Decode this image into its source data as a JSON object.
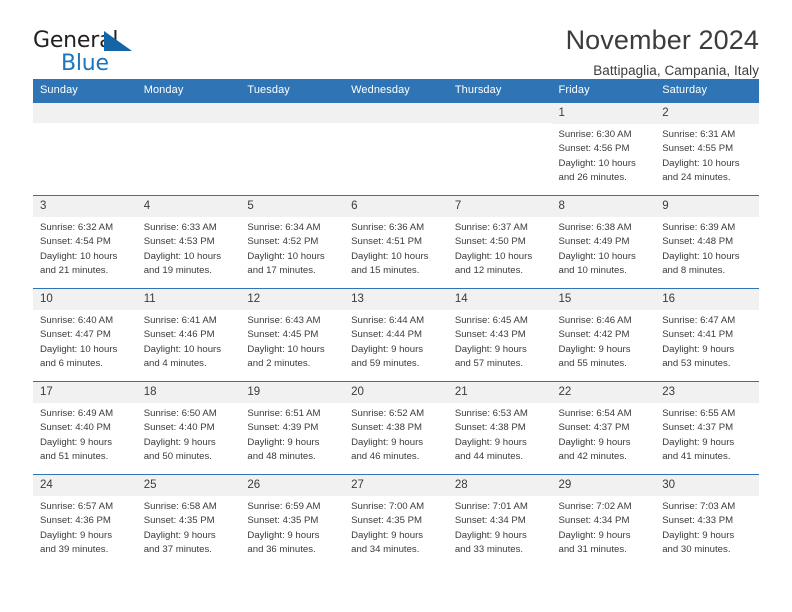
{
  "brand": {
    "name_part1": "General",
    "name_part2": "Blue",
    "logo_icon": "triangle-flag-icon"
  },
  "header": {
    "title": "November 2024",
    "subtitle": "Battipaglia, Campania, Italy"
  },
  "colors": {
    "header_blue": "#2f75b5",
    "brand_blue": "#1d75bd",
    "daynum_bg": "#f1f1f1",
    "text": "#3b3b3b"
  },
  "weekdays": [
    "Sunday",
    "Monday",
    "Tuesday",
    "Wednesday",
    "Thursday",
    "Friday",
    "Saturday"
  ],
  "weeks": [
    [
      {
        "day": "",
        "sunrise": "",
        "sunset": "",
        "daylight1": "",
        "daylight2": ""
      },
      {
        "day": "",
        "sunrise": "",
        "sunset": "",
        "daylight1": "",
        "daylight2": ""
      },
      {
        "day": "",
        "sunrise": "",
        "sunset": "",
        "daylight1": "",
        "daylight2": ""
      },
      {
        "day": "",
        "sunrise": "",
        "sunset": "",
        "daylight1": "",
        "daylight2": ""
      },
      {
        "day": "",
        "sunrise": "",
        "sunset": "",
        "daylight1": "",
        "daylight2": ""
      },
      {
        "day": "1",
        "sunrise": "Sunrise: 6:30 AM",
        "sunset": "Sunset: 4:56 PM",
        "daylight1": "Daylight: 10 hours",
        "daylight2": "and 26 minutes."
      },
      {
        "day": "2",
        "sunrise": "Sunrise: 6:31 AM",
        "sunset": "Sunset: 4:55 PM",
        "daylight1": "Daylight: 10 hours",
        "daylight2": "and 24 minutes."
      }
    ],
    [
      {
        "day": "3",
        "sunrise": "Sunrise: 6:32 AM",
        "sunset": "Sunset: 4:54 PM",
        "daylight1": "Daylight: 10 hours",
        "daylight2": "and 21 minutes."
      },
      {
        "day": "4",
        "sunrise": "Sunrise: 6:33 AM",
        "sunset": "Sunset: 4:53 PM",
        "daylight1": "Daylight: 10 hours",
        "daylight2": "and 19 minutes."
      },
      {
        "day": "5",
        "sunrise": "Sunrise: 6:34 AM",
        "sunset": "Sunset: 4:52 PM",
        "daylight1": "Daylight: 10 hours",
        "daylight2": "and 17 minutes."
      },
      {
        "day": "6",
        "sunrise": "Sunrise: 6:36 AM",
        "sunset": "Sunset: 4:51 PM",
        "daylight1": "Daylight: 10 hours",
        "daylight2": "and 15 minutes."
      },
      {
        "day": "7",
        "sunrise": "Sunrise: 6:37 AM",
        "sunset": "Sunset: 4:50 PM",
        "daylight1": "Daylight: 10 hours",
        "daylight2": "and 12 minutes."
      },
      {
        "day": "8",
        "sunrise": "Sunrise: 6:38 AM",
        "sunset": "Sunset: 4:49 PM",
        "daylight1": "Daylight: 10 hours",
        "daylight2": "and 10 minutes."
      },
      {
        "day": "9",
        "sunrise": "Sunrise: 6:39 AM",
        "sunset": "Sunset: 4:48 PM",
        "daylight1": "Daylight: 10 hours",
        "daylight2": "and 8 minutes."
      }
    ],
    [
      {
        "day": "10",
        "sunrise": "Sunrise: 6:40 AM",
        "sunset": "Sunset: 4:47 PM",
        "daylight1": "Daylight: 10 hours",
        "daylight2": "and 6 minutes."
      },
      {
        "day": "11",
        "sunrise": "Sunrise: 6:41 AM",
        "sunset": "Sunset: 4:46 PM",
        "daylight1": "Daylight: 10 hours",
        "daylight2": "and 4 minutes."
      },
      {
        "day": "12",
        "sunrise": "Sunrise: 6:43 AM",
        "sunset": "Sunset: 4:45 PM",
        "daylight1": "Daylight: 10 hours",
        "daylight2": "and 2 minutes."
      },
      {
        "day": "13",
        "sunrise": "Sunrise: 6:44 AM",
        "sunset": "Sunset: 4:44 PM",
        "daylight1": "Daylight: 9 hours",
        "daylight2": "and 59 minutes."
      },
      {
        "day": "14",
        "sunrise": "Sunrise: 6:45 AM",
        "sunset": "Sunset: 4:43 PM",
        "daylight1": "Daylight: 9 hours",
        "daylight2": "and 57 minutes."
      },
      {
        "day": "15",
        "sunrise": "Sunrise: 6:46 AM",
        "sunset": "Sunset: 4:42 PM",
        "daylight1": "Daylight: 9 hours",
        "daylight2": "and 55 minutes."
      },
      {
        "day": "16",
        "sunrise": "Sunrise: 6:47 AM",
        "sunset": "Sunset: 4:41 PM",
        "daylight1": "Daylight: 9 hours",
        "daylight2": "and 53 minutes."
      }
    ],
    [
      {
        "day": "17",
        "sunrise": "Sunrise: 6:49 AM",
        "sunset": "Sunset: 4:40 PM",
        "daylight1": "Daylight: 9 hours",
        "daylight2": "and 51 minutes."
      },
      {
        "day": "18",
        "sunrise": "Sunrise: 6:50 AM",
        "sunset": "Sunset: 4:40 PM",
        "daylight1": "Daylight: 9 hours",
        "daylight2": "and 50 minutes."
      },
      {
        "day": "19",
        "sunrise": "Sunrise: 6:51 AM",
        "sunset": "Sunset: 4:39 PM",
        "daylight1": "Daylight: 9 hours",
        "daylight2": "and 48 minutes."
      },
      {
        "day": "20",
        "sunrise": "Sunrise: 6:52 AM",
        "sunset": "Sunset: 4:38 PM",
        "daylight1": "Daylight: 9 hours",
        "daylight2": "and 46 minutes."
      },
      {
        "day": "21",
        "sunrise": "Sunrise: 6:53 AM",
        "sunset": "Sunset: 4:38 PM",
        "daylight1": "Daylight: 9 hours",
        "daylight2": "and 44 minutes."
      },
      {
        "day": "22",
        "sunrise": "Sunrise: 6:54 AM",
        "sunset": "Sunset: 4:37 PM",
        "daylight1": "Daylight: 9 hours",
        "daylight2": "and 42 minutes."
      },
      {
        "day": "23",
        "sunrise": "Sunrise: 6:55 AM",
        "sunset": "Sunset: 4:37 PM",
        "daylight1": "Daylight: 9 hours",
        "daylight2": "and 41 minutes."
      }
    ],
    [
      {
        "day": "24",
        "sunrise": "Sunrise: 6:57 AM",
        "sunset": "Sunset: 4:36 PM",
        "daylight1": "Daylight: 9 hours",
        "daylight2": "and 39 minutes."
      },
      {
        "day": "25",
        "sunrise": "Sunrise: 6:58 AM",
        "sunset": "Sunset: 4:35 PM",
        "daylight1": "Daylight: 9 hours",
        "daylight2": "and 37 minutes."
      },
      {
        "day": "26",
        "sunrise": "Sunrise: 6:59 AM",
        "sunset": "Sunset: 4:35 PM",
        "daylight1": "Daylight: 9 hours",
        "daylight2": "and 36 minutes."
      },
      {
        "day": "27",
        "sunrise": "Sunrise: 7:00 AM",
        "sunset": "Sunset: 4:35 PM",
        "daylight1": "Daylight: 9 hours",
        "daylight2": "and 34 minutes."
      },
      {
        "day": "28",
        "sunrise": "Sunrise: 7:01 AM",
        "sunset": "Sunset: 4:34 PM",
        "daylight1": "Daylight: 9 hours",
        "daylight2": "and 33 minutes."
      },
      {
        "day": "29",
        "sunrise": "Sunrise: 7:02 AM",
        "sunset": "Sunset: 4:34 PM",
        "daylight1": "Daylight: 9 hours",
        "daylight2": "and 31 minutes."
      },
      {
        "day": "30",
        "sunrise": "Sunrise: 7:03 AM",
        "sunset": "Sunset: 4:33 PM",
        "daylight1": "Daylight: 9 hours",
        "daylight2": "and 30 minutes."
      }
    ]
  ]
}
